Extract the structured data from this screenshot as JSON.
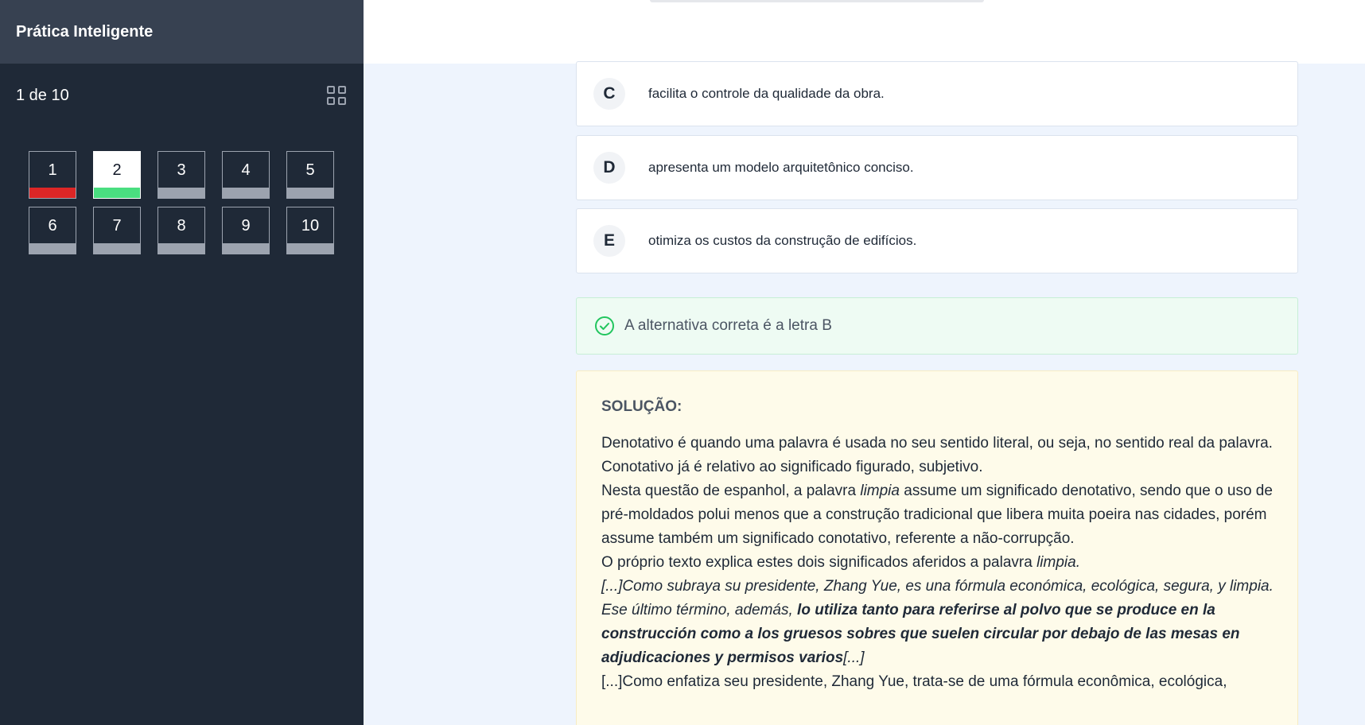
{
  "sidebar": {
    "app_title": "Prática Inteligente",
    "counter": "1 de 10",
    "grid_icon": "grid-icon",
    "questions": [
      {
        "label": "1",
        "status_color": "#dc2626"
      },
      {
        "label": "2",
        "status_color": "#4ade80"
      },
      {
        "label": "3",
        "status_color": "#9ca3af"
      },
      {
        "label": "4",
        "status_color": "#9ca3af"
      },
      {
        "label": "5",
        "status_color": "#9ca3af"
      },
      {
        "label": "6",
        "status_color": "#9ca3af"
      },
      {
        "label": "7",
        "status_color": "#9ca3af"
      },
      {
        "label": "8",
        "status_color": "#9ca3af"
      },
      {
        "label": "9",
        "status_color": "#9ca3af"
      },
      {
        "label": "10",
        "status_color": "#9ca3af"
      }
    ]
  },
  "options": [
    {
      "letter": "C",
      "text": "facilita o controle da qualidade da obra."
    },
    {
      "letter": "D",
      "text": "apresenta um modelo arquitetônico conciso."
    },
    {
      "letter": "E",
      "text": "otimiza os custos da construção de edifícios."
    }
  ],
  "feedback": {
    "icon": "check-circle-icon",
    "message": "A alternativa correta é a letra B",
    "color": "#22c55e"
  },
  "solution": {
    "heading": "SOLUÇÃO:",
    "p1": "Denotativo é quando uma palavra é usada no seu sentido literal, ou seja, no sentido real da palavra.",
    "p2": "Conotativo já é relativo ao significado figurado, subjetivo.",
    "p3_a": "Nesta questão de espanhol, a palavra ",
    "p3_em": "limpia",
    "p3_b": " assume um significado denotativo, sendo que o uso de pré-moldados polui menos que a construção tradicional que libera muita poeira nas cidades, porém assume também um significado conotativo, referente a não-corrupção.",
    "p4_a": "O próprio texto explica estes dois significados aferidos a palavra ",
    "p4_em": "limpia.",
    "p5_em": "[...]Como subraya su presidente, Zhang Yue, es una fórmula económica, ecológica, segura, y limpia. Ese último término, además, ",
    "p5_strong": "lo utiliza tanto para referirse al polvo que se produce en la construcción como a los gruesos sobres que suelen circular por debajo de las mesas en adjudicaciones y permisos varios",
    "p5_end": "[...]",
    "p6": "[...]Como enfatiza seu presidente, Zhang Yue, trata-se de uma fórmula econômica, ecológica,"
  }
}
